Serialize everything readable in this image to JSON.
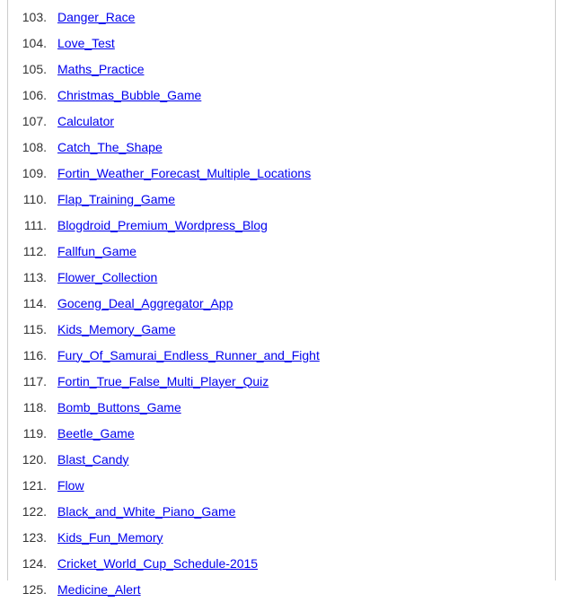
{
  "list": {
    "start": 103,
    "items": [
      {
        "n": "103.",
        "label": "Danger_Race"
      },
      {
        "n": "104.",
        "label": "Love_Test"
      },
      {
        "n": "105.",
        "label": "Maths_Practice"
      },
      {
        "n": "106.",
        "label": "Christmas_Bubble_Game"
      },
      {
        "n": "107.",
        "label": "Calculator"
      },
      {
        "n": "108.",
        "label": "Catch_The_Shape"
      },
      {
        "n": "109.",
        "label": "Fortin_Weather_Forecast_Multiple_Locations"
      },
      {
        "n": "110.",
        "label": "Flap_Training_Game"
      },
      {
        "n": "111.",
        "label": "Blogdroid_Premium_Wordpress_Blog"
      },
      {
        "n": "112.",
        "label": "Fallfun_Game"
      },
      {
        "n": "113.",
        "label": "Flower_Collection"
      },
      {
        "n": "114.",
        "label": "Goceng_Deal_Aggregator_App"
      },
      {
        "n": "115.",
        "label": "Kids_Memory_Game"
      },
      {
        "n": "116.",
        "label": "Fury_Of_Samurai_Endless_Runner_and_Fight"
      },
      {
        "n": "117.",
        "label": "Fortin_True_False_Multi_Player_Quiz"
      },
      {
        "n": "118.",
        "label": "Bomb_Buttons_Game"
      },
      {
        "n": "119.",
        "label": "Beetle_Game"
      },
      {
        "n": "120.",
        "label": "Blast_Candy"
      },
      {
        "n": "121.",
        "label": "Flow"
      },
      {
        "n": "122.",
        "label": "Black_and_White_Piano_Game"
      },
      {
        "n": "123.",
        "label": "Kids_Fun_Memory"
      },
      {
        "n": "124.",
        "label": "Cricket_World_Cup_Schedule-2015"
      },
      {
        "n": "125.",
        "label": "Medicine_Alert"
      }
    ]
  }
}
